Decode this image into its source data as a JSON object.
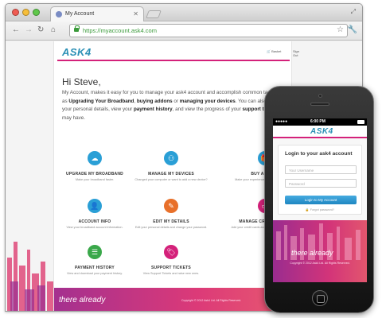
{
  "browser": {
    "tab_title": "My Account",
    "url": "https://myaccount.ask4.com"
  },
  "site": {
    "logo": "ASK4",
    "header_links": [
      "Basket",
      "Sign Out"
    ],
    "greeting": "Hi Steve,",
    "intro": {
      "p1": "My Account, makes it easy for you to manage your ask4 account and accomplish common tasks such as",
      "b1": "Upgrading Your Broadband",
      "sep1": ",",
      "b2": "buying addons",
      "sep2": "or",
      "b3": "managing your devices",
      "p2": ". You can also change your personal details, view your",
      "b4": "payment history",
      "p3": ", and view the progress of your",
      "b5": "support tickets",
      "p4": "you may have."
    },
    "tiles": [
      {
        "icon": "cloud-icon",
        "title": "UPGRADE MY BROADBAND",
        "desc": "Make your broadband faster.",
        "color": "#2a9fd6"
      },
      {
        "icon": "devices-icon",
        "title": "MANAGE MY DEVICES",
        "desc": "Changed your computer or want to add a new device?",
        "color": "#2a9fd6"
      },
      {
        "icon": "gift-icon",
        "title": "BUY ADDONS",
        "desc": "Make your experience more fun with addons.",
        "color": "#2a9fd6"
      },
      {
        "icon": "info-icon",
        "title": "ACCOUNT INFO",
        "desc": "View your broadband account information.",
        "color": "#2a9fd6"
      },
      {
        "icon": "edit-icon",
        "title": "EDIT MY DETAILS",
        "desc": "Edit your personal details and change your password.",
        "color": "#e8702a"
      },
      {
        "icon": "card-icon",
        "title": "MANAGE CREDIT CARDS",
        "desc": "Add your credit cards and manage your payments.",
        "color": "#d4217a"
      },
      {
        "icon": "list-icon",
        "title": "PAYMENT HISTORY",
        "desc": "View and download your payment history.",
        "color": "#3aa84a"
      },
      {
        "icon": "tag-icon",
        "title": "SUPPORT TICKETS",
        "desc": "View Support Tickets and raise new ones.",
        "color": "#d4217a"
      }
    ],
    "tagline": "there already",
    "copyright": "Copyright © 2012 Ask4 Ltd. All Rights Reserved."
  },
  "phone": {
    "carrier": "●●●●● ",
    "time": "6:00 PM",
    "logo": "ASK4",
    "login_title": "Login to your ask4 account",
    "username_placeholder": "Your Username",
    "password_placeholder": "Password",
    "login_button": "Login to My Account",
    "forgot": "Forgot password?",
    "tagline": "there already",
    "copyright": "Copyright © 2012 Ask4 Ltd. All Rights Reserved."
  },
  "colors": {
    "brand_blue": "#2a8fb5",
    "brand_pink": "#d4217a"
  }
}
